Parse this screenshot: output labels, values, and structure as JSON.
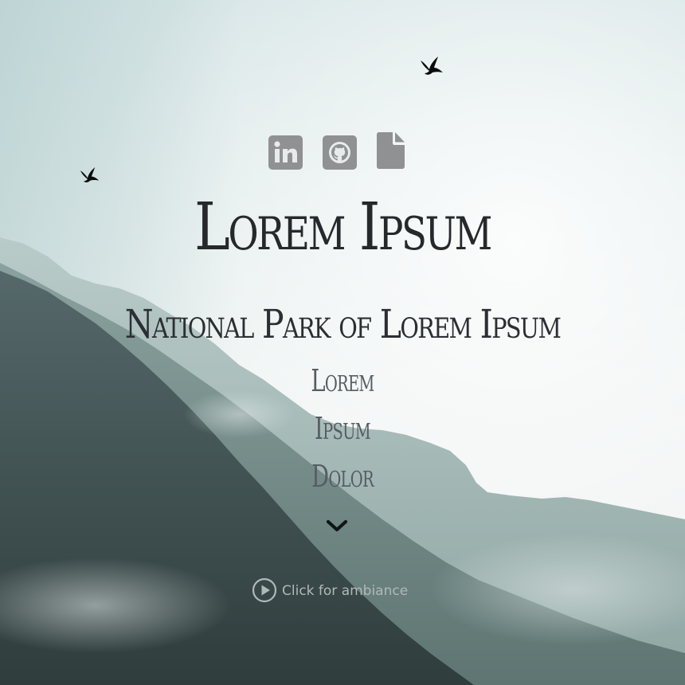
{
  "hero": {
    "title": "Lorem Ipsum",
    "subtitle": "National Park of Lorem Ipsum"
  },
  "social": {
    "icons": [
      "linkedin-icon",
      "github-icon",
      "file-icon"
    ]
  },
  "nav": {
    "links": [
      {
        "label": "Lorem"
      },
      {
        "label": "Ipsum"
      },
      {
        "label": "Dolor"
      }
    ]
  },
  "scroll_down": {
    "icon": "chevron-down-icon"
  },
  "ambiance": {
    "label": "Click for ambiance",
    "icon": "play-circle-icon"
  },
  "decorations": {
    "birds": [
      "bird-icon",
      "bird-icon"
    ]
  },
  "colors": {
    "sky_top": "#dde9ea",
    "sky_bottom": "#f3f6f5",
    "mountain_far": "#aec1be",
    "mountain_mid": "#7f9795",
    "mountain_near": "#42524f",
    "title_text": "#26292c",
    "icon_gray": "#8f9192",
    "ambiance_text": "#b2b8b8"
  }
}
